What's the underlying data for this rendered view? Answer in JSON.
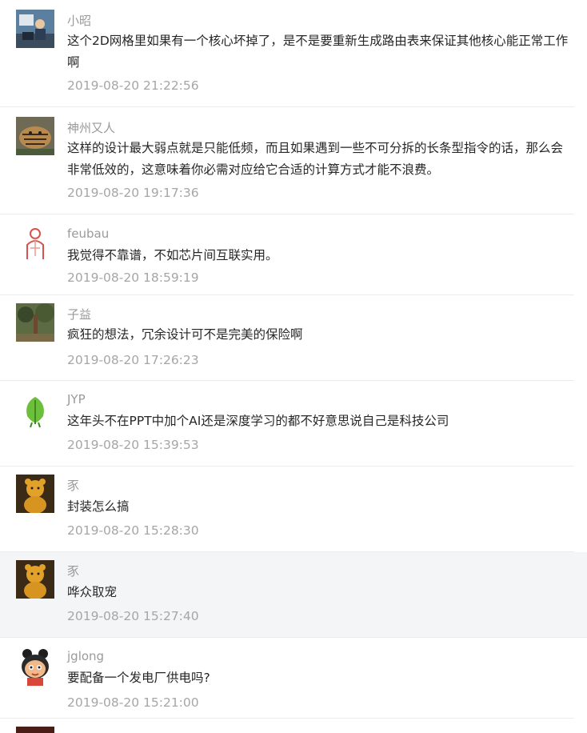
{
  "comments": [
    {
      "user": "小昭",
      "text": "这个2D网格里如果有一个核心坏掉了，是不是要重新生成路由表来保证其他核心能正常工作啊",
      "time": "2019-08-20 21:22:56",
      "avatar_icon": "person-at-computer-avatar-icon"
    },
    {
      "user": "神州又人",
      "text": "这样的设计最大弱点就是只能低频，而且如果遇到一些不可分拆的长条型指令的话，那么会非常低效的，这意味着你必需对应给它合适的计算方式才能不浪费。",
      "time": "2019-08-20 19:17:36",
      "avatar_icon": "tiger-avatar-icon"
    },
    {
      "user": "feubau",
      "text": "我觉得不靠谱，不如芯片间互联实用。",
      "time": "2019-08-20 18:59:19",
      "avatar_icon": "sketch-figure-avatar-icon"
    },
    {
      "user": "子益",
      "text": "疯狂的想法，冗余设计可不是完美的保险啊",
      "time": "2019-08-20 17:26:23",
      "avatar_icon": "forest-avatar-icon"
    },
    {
      "user": "JYP",
      "text": "这年头不在PPT中加个AI还是深度学习的都不好意思说自己是科技公司",
      "time": "2019-08-20 15:39:53",
      "avatar_icon": "green-leaf-avatar-icon"
    },
    {
      "user": "豕",
      "text": "封装怎么搞",
      "time": "2019-08-20 15:28:30",
      "avatar_icon": "winnie-the-pooh-avatar-icon"
    },
    {
      "user": "豕",
      "text": "哗众取宠",
      "time": "2019-08-20 15:27:40",
      "avatar_icon": "winnie-the-pooh-avatar-icon"
    },
    {
      "user": "jglong",
      "text": "要配备一个发电厂供电吗?",
      "time": "2019-08-20 15:21:00",
      "avatar_icon": "cartoon-girl-avatar-icon"
    }
  ]
}
